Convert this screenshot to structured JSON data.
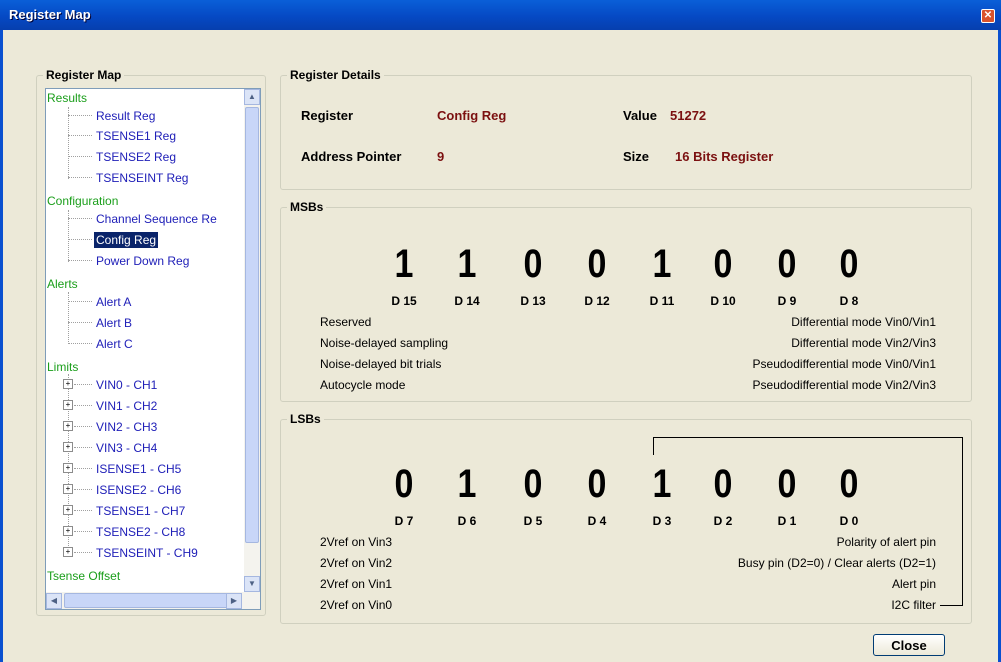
{
  "window": {
    "title": "Register Map"
  },
  "register_map": {
    "group_title": "Register Map",
    "tree": {
      "results": {
        "label": "Results",
        "items": [
          "Result Reg",
          "TSENSE1 Reg",
          "TSENSE2 Reg",
          "TSENSEINT Reg"
        ]
      },
      "configuration": {
        "label": "Configuration",
        "items": [
          "Channel Sequence Re",
          "Config Reg",
          "Power Down Reg"
        ]
      },
      "alerts": {
        "label": "Alerts",
        "items": [
          "Alert A",
          "Alert B",
          "Alert C"
        ]
      },
      "limits": {
        "label": "Limits",
        "items": [
          "VIN0 - CH1",
          "VIN1 - CH2",
          "VIN2 - CH3",
          "VIN3 - CH4",
          "ISENSE1 - CH5",
          "ISENSE2 - CH6",
          "TSENSE1 - CH7",
          "TSENSE2 - CH8",
          "TSENSEINT - CH9"
        ]
      },
      "tsense_offset": {
        "label": "Tsense Offset"
      }
    },
    "selected": "Config Reg"
  },
  "details": {
    "group_title": "Register Details",
    "register_label": "Register",
    "register_value": "Config Reg",
    "value_label": "Value",
    "value_value": "51272",
    "address_label": "Address Pointer",
    "address_value": "9",
    "size_label": "Size",
    "size_value": "16 Bits Register"
  },
  "msbs": {
    "group_title": "MSBs",
    "bits": [
      "1",
      "1",
      "0",
      "0",
      "1",
      "0",
      "0",
      "0"
    ],
    "labels": [
      "D 15",
      "D 14",
      "D 13",
      "D 12",
      "D 11",
      "D 10",
      "D 9",
      "D 8"
    ],
    "left_desc": [
      "Reserved",
      "Noise-delayed sampling",
      "Noise-delayed bit trials",
      "Autocycle mode"
    ],
    "right_desc": [
      "Differential mode Vin0/Vin1",
      "Differential mode Vin2/Vin3",
      "Pseudodifferential mode Vin0/Vin1",
      "Pseudodifferential mode Vin2/Vin3"
    ]
  },
  "lsbs": {
    "group_title": "LSBs",
    "bits": [
      "0",
      "1",
      "0",
      "0",
      "1",
      "0",
      "0",
      "0"
    ],
    "labels": [
      "D 7",
      "D 6",
      "D 5",
      "D 4",
      "D 3",
      "D 2",
      "D 1",
      "D 0"
    ],
    "left_desc": [
      "2Vref on Vin3",
      "2Vref on Vin2",
      "2Vref on Vin1",
      "2Vref on Vin0"
    ],
    "right_desc": [
      "Polarity of alert pin",
      "Busy pin (D2=0) / Clear alerts (D2=1)",
      "Alert pin",
      "I2C filter"
    ]
  },
  "buttons": {
    "close": "Close"
  },
  "icons": {
    "close_window": "close-icon"
  }
}
